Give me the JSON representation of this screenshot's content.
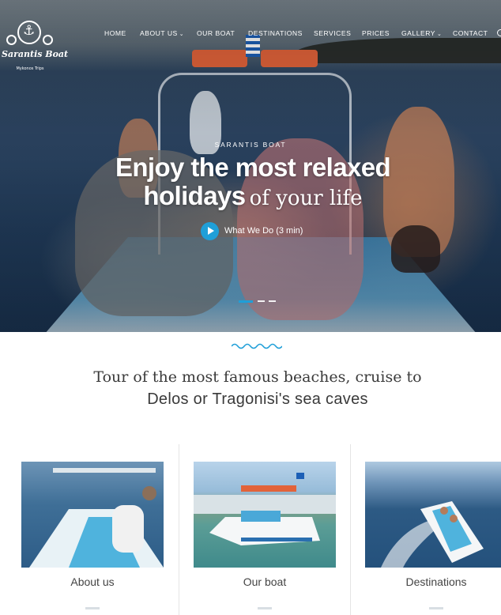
{
  "brand": {
    "name": "Sarantis Boat",
    "tagline": "Mykonos Trips"
  },
  "nav": {
    "items": [
      {
        "label": "HOME",
        "dropdown": false
      },
      {
        "label": "ABOUT US",
        "dropdown": true
      },
      {
        "label": "OUR BOAT",
        "dropdown": false
      },
      {
        "label": "DESTINATIONS",
        "dropdown": false
      },
      {
        "label": "SERVICES",
        "dropdown": false
      },
      {
        "label": "PRICES",
        "dropdown": false
      },
      {
        "label": "GALLERY",
        "dropdown": true
      },
      {
        "label": "CONTACT",
        "dropdown": false
      }
    ],
    "dropdown_icon": "chevron-down-icon",
    "search_icon": "search-icon"
  },
  "hero": {
    "kicker": "SARANTIS BOAT",
    "headline_line1": "Enjoy the most relaxed",
    "headline_line2_bold": "holidays",
    "headline_line2_serif": "of your life",
    "video_label": "What We Do (3 min)",
    "slides_total": 3,
    "slide_active": 1
  },
  "intro": {
    "line1": "Tour of the most famous beaches, cruise to",
    "line2": "Delos or Tragonisi's sea caves"
  },
  "cards": [
    {
      "label": "About us"
    },
    {
      "label": "Our boat"
    },
    {
      "label": "Destinations"
    }
  ],
  "colors": {
    "accent": "#1f9fd8",
    "text_dark": "#3a3a3a"
  }
}
